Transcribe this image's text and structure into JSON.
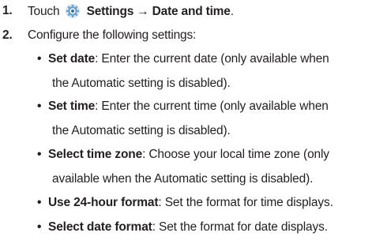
{
  "steps": [
    {
      "number": "1.",
      "prefix": "Touch",
      "icon": "settings-gear-icon",
      "bold_text": "Settings → Date and time",
      "suffix": "."
    },
    {
      "number": "2.",
      "text": "Configure the following settings:"
    }
  ],
  "bullets": [
    {
      "term": "Set date",
      "line1": ": Enter the current date (only available when",
      "line2": "the Automatic setting is disabled)."
    },
    {
      "term": "Set time",
      "line1": ": Enter the current time (only available when",
      "line2": "the Automatic setting is disabled)."
    },
    {
      "term": "Select time zone",
      "line1": ": Choose your local time zone (only",
      "line2": "available when the Automatic setting is disabled)."
    },
    {
      "term": "Use 24-hour format",
      "line1": ": Set the format for time displays."
    },
    {
      "term": "Select date format",
      "line1": ": Set the format for date displays."
    }
  ],
  "colors": {
    "text": "#231f20",
    "icon_blue": "#6fa3c8"
  }
}
